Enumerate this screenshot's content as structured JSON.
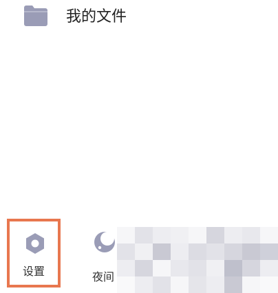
{
  "menu": {
    "files": {
      "label": "我的文件",
      "icon": "folder-icon"
    }
  },
  "bottom_bar": {
    "settings": {
      "label": "设置",
      "icon": "gear-icon",
      "highlight_color": "#e8774f"
    },
    "night_mode": {
      "label": "夜间",
      "icon": "moon-icon"
    }
  },
  "colors": {
    "icon": "#9a9cb6",
    "text": "#222222",
    "highlight": "#e8774f"
  }
}
